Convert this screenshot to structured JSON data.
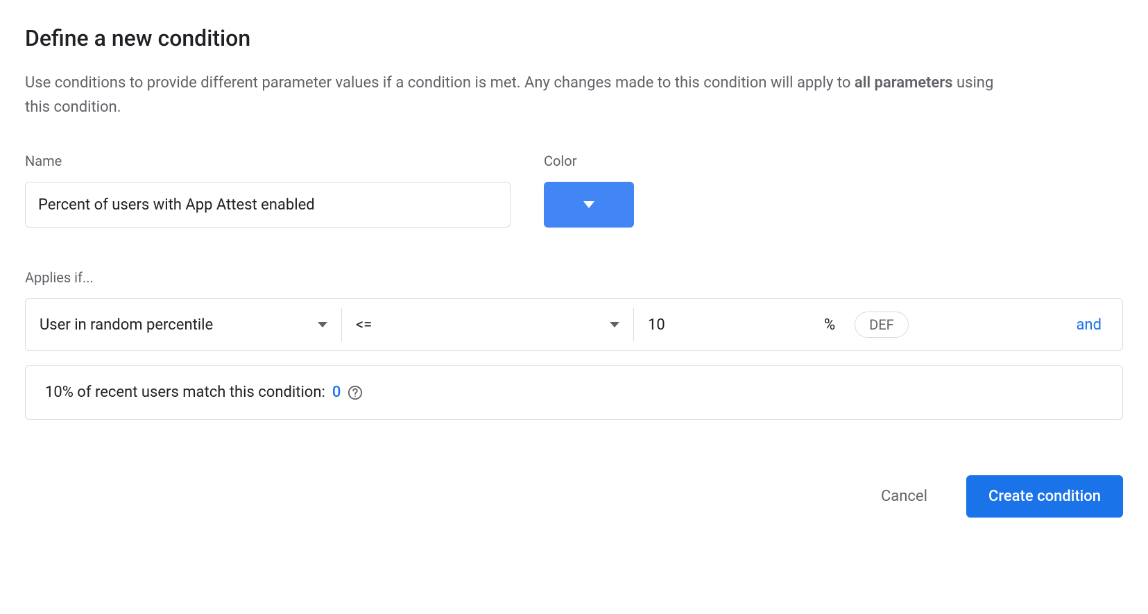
{
  "title": "Define a new condition",
  "description": {
    "prefix": "Use conditions to provide different parameter values if a condition is met. Any changes made to this condition will apply to ",
    "bold": "all parameters",
    "suffix": " using this condition."
  },
  "fields": {
    "name_label": "Name",
    "name_value": "Percent of users with App Attest enabled",
    "color_label": "Color",
    "color_value": "#4285f4"
  },
  "applies": {
    "label": "Applies if...",
    "condition_type": "User in random percentile",
    "operator": "<=",
    "value": "10",
    "unit": "%",
    "def_label": "DEF",
    "and_label": "and"
  },
  "match": {
    "text": "10% of recent users match this condition: ",
    "count": "0"
  },
  "footer": {
    "cancel": "Cancel",
    "create": "Create condition"
  }
}
